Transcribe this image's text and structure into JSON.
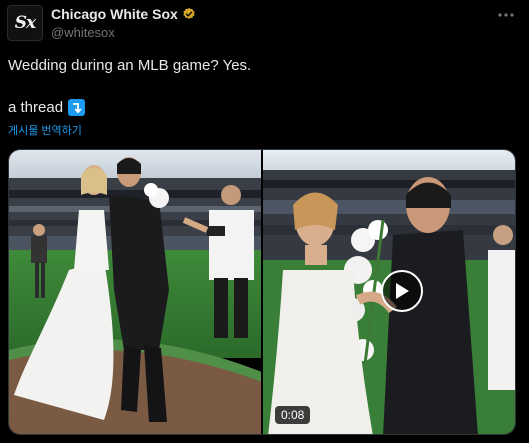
{
  "author": {
    "display_name": "Chicago White Sox",
    "handle": "@whitesox",
    "avatar_text": "Sx",
    "verified": true
  },
  "tweet": {
    "line1": "Wedding during an MLB game? Yes.",
    "line2": "a thread",
    "translate_label": "게시물 번역하기"
  },
  "media": {
    "video_duration": "0:08"
  },
  "colors": {
    "accent": "#1d9bf0",
    "verified": "#d4a72c",
    "background": "#000000"
  },
  "icons": [
    "more-icon",
    "verified-icon",
    "thread-arrow-icon",
    "play-icon"
  ]
}
